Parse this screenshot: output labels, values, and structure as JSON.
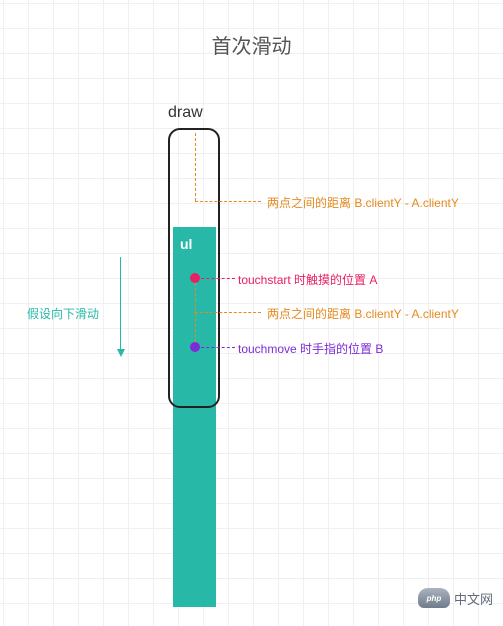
{
  "title": "首次滑动",
  "drawLabel": "draw",
  "ulLabel": "ul",
  "directionLabel": "假设向下滑动",
  "annotations": {
    "distance1": "两点之间的距离 B.clientY - A.clientY",
    "distance2": "两点之间的距离 B.clientY - A.clientY",
    "touchstart": "touchstart 时触摸的位置 A",
    "touchmove": "touchmove 时手指的位置 B"
  },
  "watermark": {
    "logo": "php",
    "site": "中文网"
  },
  "colors": {
    "teal": "#27b8a8",
    "orange": "#e58a1f",
    "pink": "#e91e63",
    "purple": "#7c2bd6"
  }
}
